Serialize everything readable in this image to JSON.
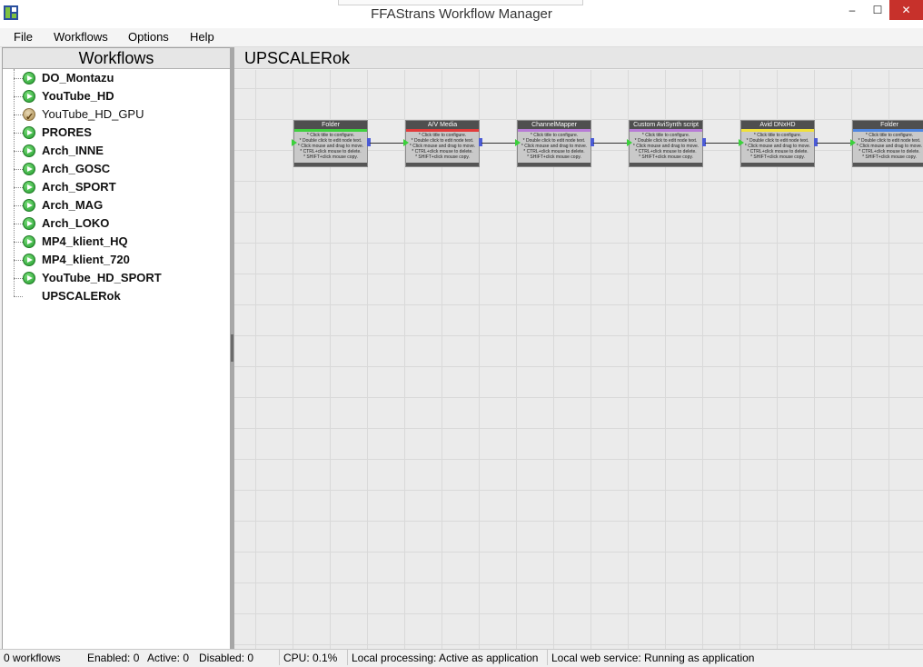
{
  "window": {
    "title": "FFAStrans Workflow Manager",
    "minimize_glyph": "–",
    "maximize_glyph": "☐",
    "close_glyph": "✕"
  },
  "menu": {
    "items": [
      "File",
      "Workflows",
      "Options",
      "Help"
    ]
  },
  "sidebar": {
    "header": "Workflows",
    "items": [
      {
        "label": "DO_Montazu",
        "status": "enabled"
      },
      {
        "label": "YouTube_HD",
        "status": "enabled"
      },
      {
        "label": "YouTube_HD_GPU",
        "status": "gpu"
      },
      {
        "label": "PRORES",
        "status": "enabled"
      },
      {
        "label": "Arch_INNE",
        "status": "enabled"
      },
      {
        "label": "Arch_GOSC",
        "status": "enabled"
      },
      {
        "label": "Arch_SPORT",
        "status": "enabled"
      },
      {
        "label": "Arch_MAG",
        "status": "enabled"
      },
      {
        "label": "Arch_LOKO",
        "status": "enabled"
      },
      {
        "label": "MP4_klient_HQ",
        "status": "enabled"
      },
      {
        "label": "MP4_klient_720",
        "status": "enabled"
      },
      {
        "label": "YouTube_HD_SPORT",
        "status": "enabled"
      },
      {
        "label": "UPSCALERok",
        "status": "selected"
      }
    ]
  },
  "canvas": {
    "title": "UPSCALERok",
    "node_help": [
      "* Click title to configure.",
      "* Double click to edit node text.",
      "* Click mouse and drag to move.",
      "* CTRL+click mouse to delete.",
      "* SHIFT+click mouse copy."
    ],
    "nodes": [
      {
        "title": "Folder",
        "color": "#3fcf3f"
      },
      {
        "title": "A/V Media",
        "color": "#e23b3b"
      },
      {
        "title": "ChannelMapper",
        "color": "#b77bd6"
      },
      {
        "title": "Custom AviSynth script",
        "color": "#b77bd6"
      },
      {
        "title": "Avid DNxHD",
        "color": "#f0e03a"
      },
      {
        "title": "Folder",
        "color": "#4f86e0"
      }
    ]
  },
  "statusbar": {
    "workflows": "0 workflows",
    "enabled": "Enabled: 0",
    "active": "Active: 0",
    "disabled": "Disabled: 0",
    "cpu": "CPU: 0.1%",
    "local_processing": "Local processing: Active as application",
    "web_service": "Local web service: Running as application"
  }
}
